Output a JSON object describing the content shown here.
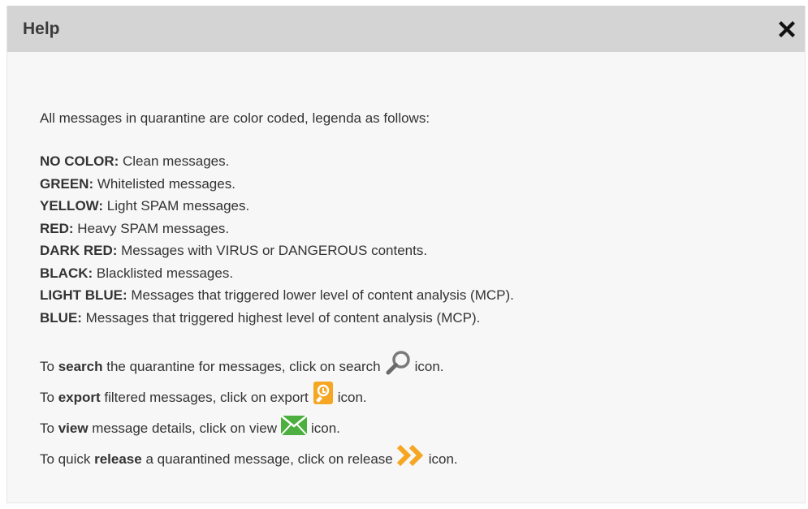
{
  "dialog": {
    "title": "Help",
    "close_icon": "close-icon"
  },
  "intro": "All messages in quarantine are color coded, legenda as follows:",
  "legend": [
    {
      "label": "NO COLOR:",
      "description": " Clean messages."
    },
    {
      "label": "GREEN:",
      "description": " Whitelisted messages."
    },
    {
      "label": "YELLOW:",
      "description": " Light SPAM messages."
    },
    {
      "label": "RED:",
      "description": " Heavy SPAM messages."
    },
    {
      "label": "DARK RED:",
      "description": " Messages with VIRUS or DANGEROUS contents."
    },
    {
      "label": "BLACK:",
      "description": " Blacklisted messages."
    },
    {
      "label": "LIGHT BLUE:",
      "description": " Messages that triggered lower level of content analysis (MCP)."
    },
    {
      "label": "BLUE:",
      "description": " Messages that triggered highest level of content analysis (MCP)."
    }
  ],
  "instructions": [
    {
      "before": "To ",
      "keyword": "search",
      "after": " the quarantine for messages, click on search",
      "icon": "search-icon",
      "end": "icon."
    },
    {
      "before": "To ",
      "keyword": "export",
      "after": " filtered messages, click on export",
      "icon": "export-icon",
      "end": "icon."
    },
    {
      "before": "To ",
      "keyword": "view",
      "after": " message details, click on view",
      "icon": "envelope-icon",
      "end": "icon."
    },
    {
      "before": "To quick ",
      "keyword": "release",
      "after": " a quarantined message, click on release",
      "icon": "release-icon",
      "end": "icon."
    }
  ],
  "colors": {
    "titlebar": "#d4d4d4",
    "body": "#f7f7f7",
    "export_icon": "#f5a623",
    "view_icon": "#4caf3f",
    "release_icon": "#f5a623",
    "search_icon": "#777777"
  }
}
